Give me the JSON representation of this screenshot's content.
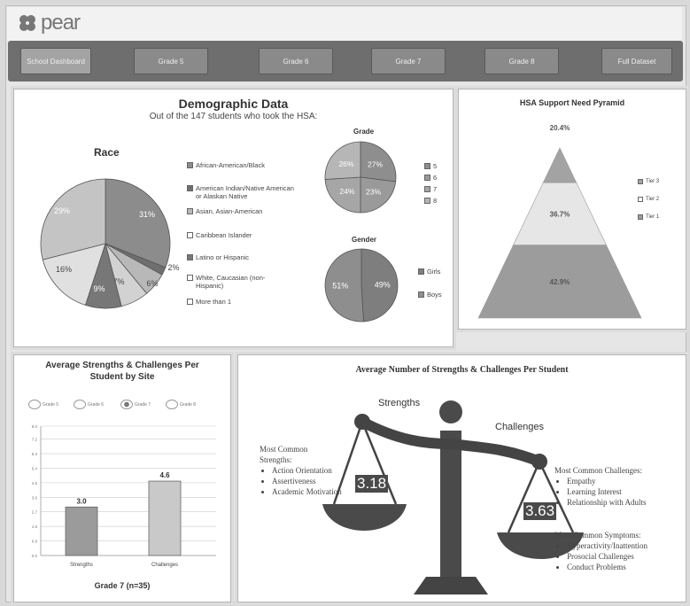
{
  "app": {
    "logo_text": "pear"
  },
  "nav": [
    {
      "label": "School Dashboard",
      "active": true
    },
    {
      "label": "Grade 5",
      "active": false
    },
    {
      "label": "Grade 6",
      "active": false
    },
    {
      "label": "Grade 7",
      "active": false
    },
    {
      "label": "Grade 8",
      "active": false
    },
    {
      "label": "Full Dataset",
      "active": false
    }
  ],
  "demographics": {
    "title": "Demographic Data",
    "subtitle": "Out of the 147 students who took the HSA:",
    "race_title": "Race",
    "grade_title": "Grade",
    "gender_title": "Gender",
    "race_legend": [
      "African-American/Black",
      "American Indian/Native American or Alaskan Native",
      "Asian, Asian-American",
      "Caribbean Islander",
      "Latino or Hispanic",
      "White, Caucasian (non-Hispanic)",
      "More than 1"
    ],
    "grade_legend": [
      "5",
      "6",
      "7",
      "8"
    ],
    "gender_legend": [
      "Girls",
      "Boys"
    ]
  },
  "pyramid": {
    "title": "HSA Support Need Pyramid",
    "legend": [
      "Tier 3",
      "Tier 2",
      "Tier 1"
    ]
  },
  "site_panel": {
    "title_line1": "Average Strengths & Challenges Per",
    "title_line2": "Student by Site",
    "radios": [
      {
        "label": "Grade 5",
        "selected": false
      },
      {
        "label": "Grade 6",
        "selected": false
      },
      {
        "label": "Grade 7",
        "selected": true
      },
      {
        "label": "Grade 8",
        "selected": false
      }
    ],
    "caption": "Grade 7 (n=35)"
  },
  "scale_panel": {
    "title": "Average Number of Strengths & Challenges Per Student",
    "strengths_label": "Strengths",
    "challenges_label": "Challenges",
    "strengths_value": "3.18",
    "challenges_value": "3.63",
    "common_strengths_title_1": "Most Common",
    "common_strengths_title_2": "Strengths:",
    "common_strengths": [
      "Action Orientation",
      "Assertiveness",
      "Academic Motivation"
    ],
    "common_challenges_title": "Most Common Challenges:",
    "common_challenges": [
      "Empathy",
      "Learning Interest",
      "Relationship with Adults"
    ],
    "common_symptoms_title": "Most Common Symptoms:",
    "common_symptoms": [
      "Hyperactivity/Inattention",
      "Prosocial Challenges",
      "Conduct Problems"
    ]
  },
  "chart_data": [
    {
      "type": "pie",
      "title": "Race",
      "categories": [
        "African-American/Black",
        "American Indian/Native American or Alaskan Native",
        "Asian, Asian-American",
        "Caribbean Islander",
        "Latino or Hispanic",
        "White, Caucasian (non-Hispanic)",
        "More than 1"
      ],
      "values": [
        31,
        2,
        6,
        7,
        9,
        16,
        29
      ],
      "labels": [
        "31%",
        "2%",
        "6%",
        "7%",
        "9%",
        "16%",
        "29%"
      ],
      "colors": [
        "#8c8c8c",
        "#6f6f6f",
        "#b8b8b8",
        "#d2d2d2",
        "#777777",
        "#e0e0e0",
        "#c4c4c4"
      ]
    },
    {
      "type": "pie",
      "title": "Grade",
      "categories": [
        "5",
        "6",
        "7",
        "8"
      ],
      "values": [
        27,
        23,
        24,
        26
      ],
      "labels": [
        "27%",
        "23%",
        "24%",
        "26%"
      ],
      "colors": [
        "#8e8e8e",
        "#9a9a9a",
        "#a6a6a6",
        "#b6b6b6"
      ]
    },
    {
      "type": "pie",
      "title": "Gender",
      "categories": [
        "Girls",
        "Boys"
      ],
      "values": [
        49,
        51
      ],
      "labels": [
        "49%",
        "51%"
      ],
      "colors": [
        "#7e7e7e",
        "#8e8e8e"
      ]
    },
    {
      "type": "area",
      "title": "HSA Support Need Pyramid",
      "categories": [
        "Tier 3",
        "Tier 2",
        "Tier 1"
      ],
      "values": [
        20.4,
        36.7,
        42.9
      ],
      "labels": [
        "20.4%",
        "36.7%",
        "42.9%"
      ],
      "colors": [
        "#a3a3a3",
        "#e6e6e6",
        "#9c9c9c"
      ]
    },
    {
      "type": "bar",
      "title": "",
      "xlabel": "Grade 7 (n=35)",
      "categories": [
        "Strengths",
        "Challenges"
      ],
      "values": [
        3.0,
        4.6
      ],
      "labels": [
        "3.0",
        "4.6"
      ],
      "ylim": [
        0,
        8
      ],
      "yticks": [
        "0.0",
        "0.9",
        "1.8",
        "2.7",
        "3.6",
        "4.5",
        "5.4",
        "6.3",
        "7.2",
        "8.0"
      ],
      "colors": [
        "#9b9b9b",
        "#c9c9c9"
      ],
      "grid": true
    }
  ]
}
